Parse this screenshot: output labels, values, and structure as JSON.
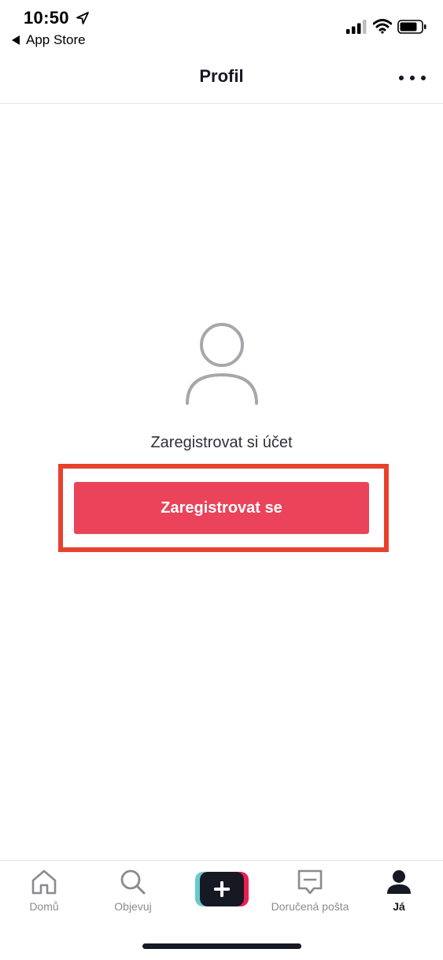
{
  "status_bar": {
    "time": "10:50",
    "back_app_label": "App Store"
  },
  "header": {
    "title": "Profil"
  },
  "main": {
    "prompt": "Zaregistrovat si účet",
    "signup_label": "Zaregistrovat se"
  },
  "bottom_nav": {
    "items": [
      {
        "label": "Domů",
        "icon": "home-icon"
      },
      {
        "label": "Objevuj",
        "icon": "search-icon"
      },
      {
        "label": "",
        "icon": "plus-icon"
      },
      {
        "label": "Doručená pošta",
        "icon": "inbox-icon"
      },
      {
        "label": "Já",
        "icon": "profile-icon"
      }
    ]
  },
  "colors": {
    "accent": "#ea435a",
    "highlight_frame": "#e8412c",
    "text_primary": "#161823",
    "text_secondary": "#8a8b91",
    "tiktok_cyan": "#69c9d0",
    "tiktok_red": "#ee1d52"
  }
}
